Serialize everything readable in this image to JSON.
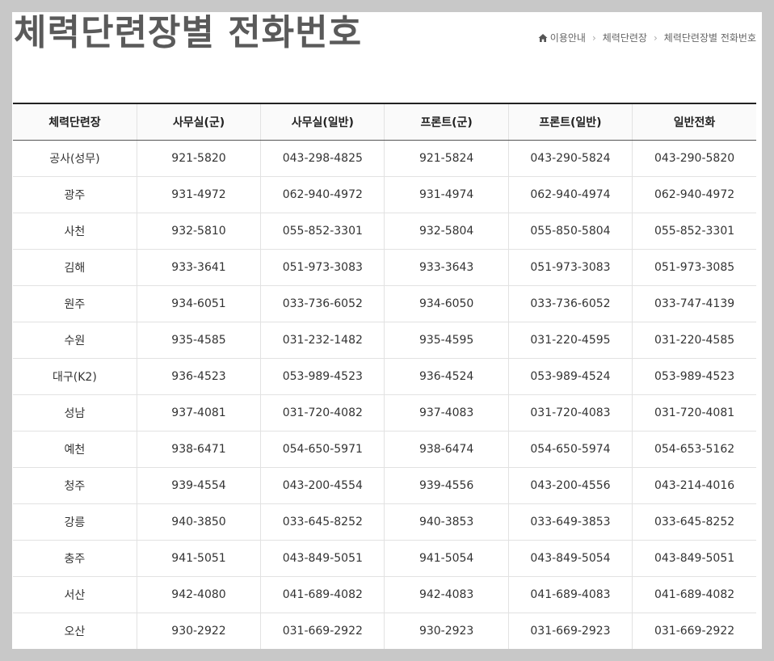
{
  "page": {
    "title": "체력단련장별 전화번호"
  },
  "breadcrumb": {
    "home_icon": "home-icon",
    "items": [
      "이용안내",
      "체력단련장",
      "체력단련장별 전화번호"
    ]
  },
  "table": {
    "headers": [
      "체력단련장",
      "사무실(군)",
      "사무실(일반)",
      "프론트(군)",
      "프론트(일반)",
      "일반전화"
    ],
    "rows": [
      [
        "공사(성무)",
        "921-5820",
        "043-298-4825",
        "921-5824",
        "043-290-5824",
        "043-290-5820"
      ],
      [
        "광주",
        "931-4972",
        "062-940-4972",
        "931-4974",
        "062-940-4974",
        "062-940-4972"
      ],
      [
        "사천",
        "932-5810",
        "055-852-3301",
        "932-5804",
        "055-850-5804",
        "055-852-3301"
      ],
      [
        "김해",
        "933-3641",
        "051-973-3083",
        "933-3643",
        "051-973-3083",
        "051-973-3085"
      ],
      [
        "원주",
        "934-6051",
        "033-736-6052",
        "934-6050",
        "033-736-6052",
        "033-747-4139"
      ],
      [
        "수원",
        "935-4585",
        "031-232-1482",
        "935-4595",
        "031-220-4595",
        "031-220-4585"
      ],
      [
        "대구(K2)",
        "936-4523",
        "053-989-4523",
        "936-4524",
        "053-989-4524",
        "053-989-4523"
      ],
      [
        "성남",
        "937-4081",
        "031-720-4082",
        "937-4083",
        "031-720-4083",
        "031-720-4081"
      ],
      [
        "예천",
        "938-6471",
        "054-650-5971",
        "938-6474",
        "054-650-5974",
        "054-653-5162"
      ],
      [
        "청주",
        "939-4554",
        "043-200-4554",
        "939-4556",
        "043-200-4556",
        "043-214-4016"
      ],
      [
        "강릉",
        "940-3850",
        "033-645-8252",
        "940-3853",
        "033-649-3853",
        "033-645-8252"
      ],
      [
        "충주",
        "941-5051",
        "043-849-5051",
        "941-5054",
        "043-849-5054",
        "043-849-5051"
      ],
      [
        "서산",
        "942-4080",
        "041-689-4082",
        "942-4083",
        "041-689-4083",
        "041-689-4082"
      ],
      [
        "오산",
        "930-2922",
        "031-669-2922",
        "930-2923",
        "031-669-2923",
        "031-669-2922"
      ]
    ]
  }
}
